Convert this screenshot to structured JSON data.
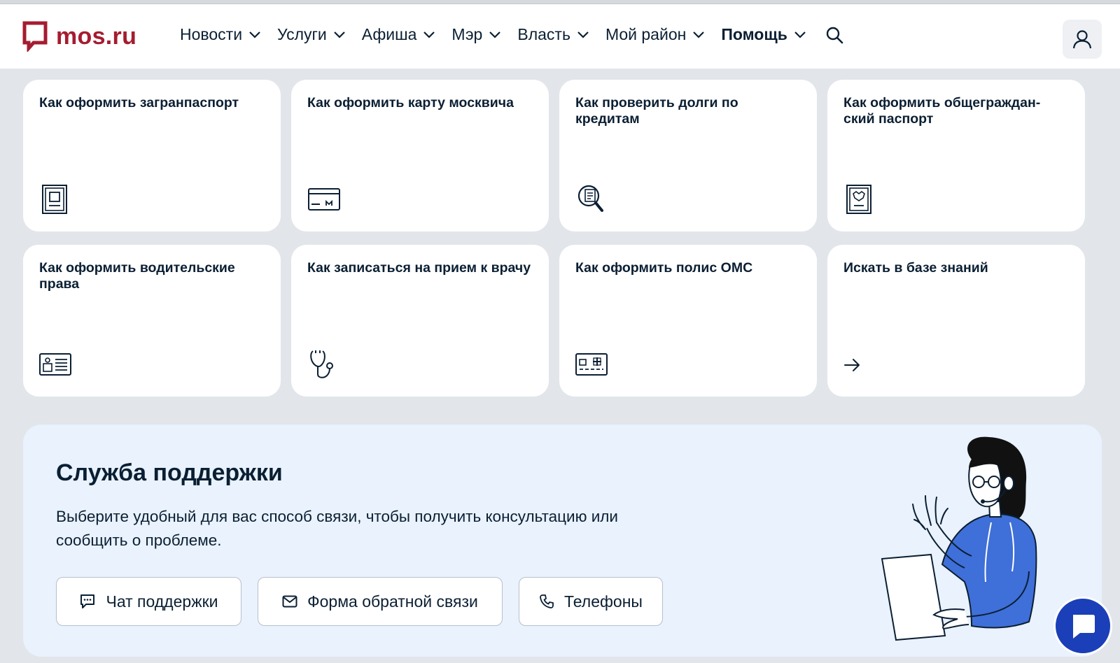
{
  "header": {
    "logo_text": "mos.ru",
    "nav": [
      {
        "label": "Новости"
      },
      {
        "label": "Услуги"
      },
      {
        "label": "Афиша"
      },
      {
        "label": "Мэр"
      },
      {
        "label": "Власть"
      },
      {
        "label": "Мой район"
      },
      {
        "label": "Помощь"
      }
    ]
  },
  "cards": [
    {
      "title": "Как оформить загранпаспорт",
      "icon": "passport-icon"
    },
    {
      "title": "Как оформить карту москвича",
      "icon": "card-icon"
    },
    {
      "title": "Как проверить долги по кредитам",
      "icon": "document-search-icon"
    },
    {
      "title": "Как оформить общеграждан-ский паспорт",
      "icon": "national-passport-icon"
    },
    {
      "title": "Как оформить водительские права",
      "icon": "driver-license-icon"
    },
    {
      "title": "Как записаться на прием к врачу",
      "icon": "stethoscope-icon"
    },
    {
      "title": "Как оформить полис ОМС",
      "icon": "medical-card-icon"
    },
    {
      "title": "Искать в базе знаний",
      "icon": "arrow-right-icon"
    }
  ],
  "support": {
    "title": "Служба поддержки",
    "description": "Выберите удобный для вас способ связи, чтобы получить консультацию или сообщить о проблеме.",
    "buttons": [
      {
        "label": "Чат поддержки",
        "icon": "chat-icon"
      },
      {
        "label": "Форма обратной связи",
        "icon": "mail-icon"
      },
      {
        "label": "Телефоны",
        "icon": "phone-icon"
      }
    ]
  },
  "colors": {
    "brand": "#a51c30",
    "page_bg": "#e2e5ea",
    "support_bg": "#e9f2fd",
    "fab": "#1a3fb8",
    "text": "#0b1f33"
  }
}
